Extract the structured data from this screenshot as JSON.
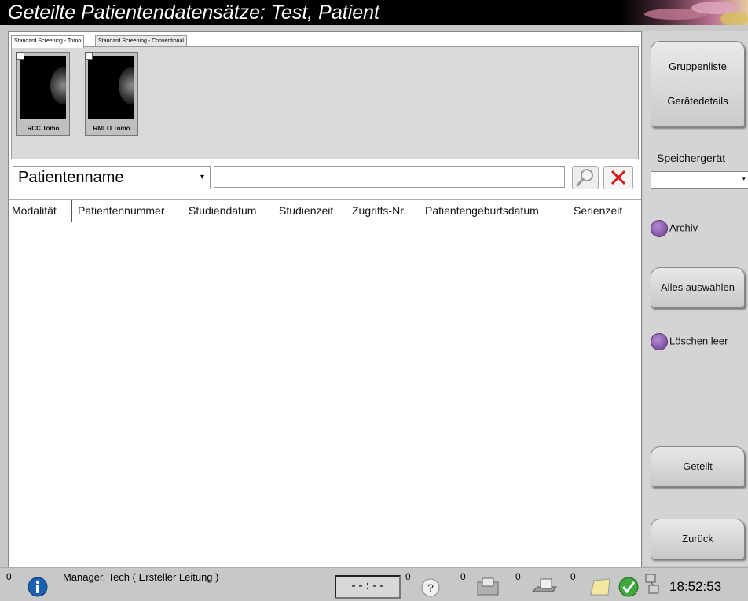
{
  "window": {
    "title": "Geteilte Patientendatensätze: Test, Patient"
  },
  "tabs": [
    {
      "label": "Standard Screening - Tomo",
      "active": true
    },
    {
      "label": "Standard Screening - Conventional",
      "active": false
    }
  ],
  "thumbnails": [
    {
      "label": "RCC Tomo"
    },
    {
      "label": "RMLO Tomo"
    }
  ],
  "search": {
    "field": "Patientenname",
    "value": "",
    "search_icon": "magnifier-icon",
    "clear_icon": "red-x-icon"
  },
  "table": {
    "columns": [
      "Modalität",
      "Patientennummer",
      "Studiendatum",
      "Studienzeit",
      "Zugriffs-Nr.",
      "Patientengeburtsdatum",
      "Serienzeit"
    ],
    "rows": []
  },
  "sidebar": {
    "group_list": "Gruppenliste",
    "device_details": "Gerätedetails",
    "storage_label": "Speichergerät",
    "storage_value": "",
    "archive": "Archiv",
    "select_all": "Alles auswählen",
    "delete_empty": "Löschen leer",
    "shared": "Geteilt",
    "back": "Zurück",
    "radio_color": "#7a4a9e"
  },
  "status": {
    "count_info": "0",
    "user": "Manager, Tech ( Ersteller Leitung )",
    "timer": "--:--",
    "count_help": "0",
    "count_output": "0",
    "count_print": "0",
    "count_notes": "0",
    "clock": "18:52:53",
    "icons": [
      "info-icon",
      "help-icon",
      "output-icon",
      "printer-icon",
      "notes-icon",
      "status-ok-icon",
      "network-icon"
    ]
  }
}
